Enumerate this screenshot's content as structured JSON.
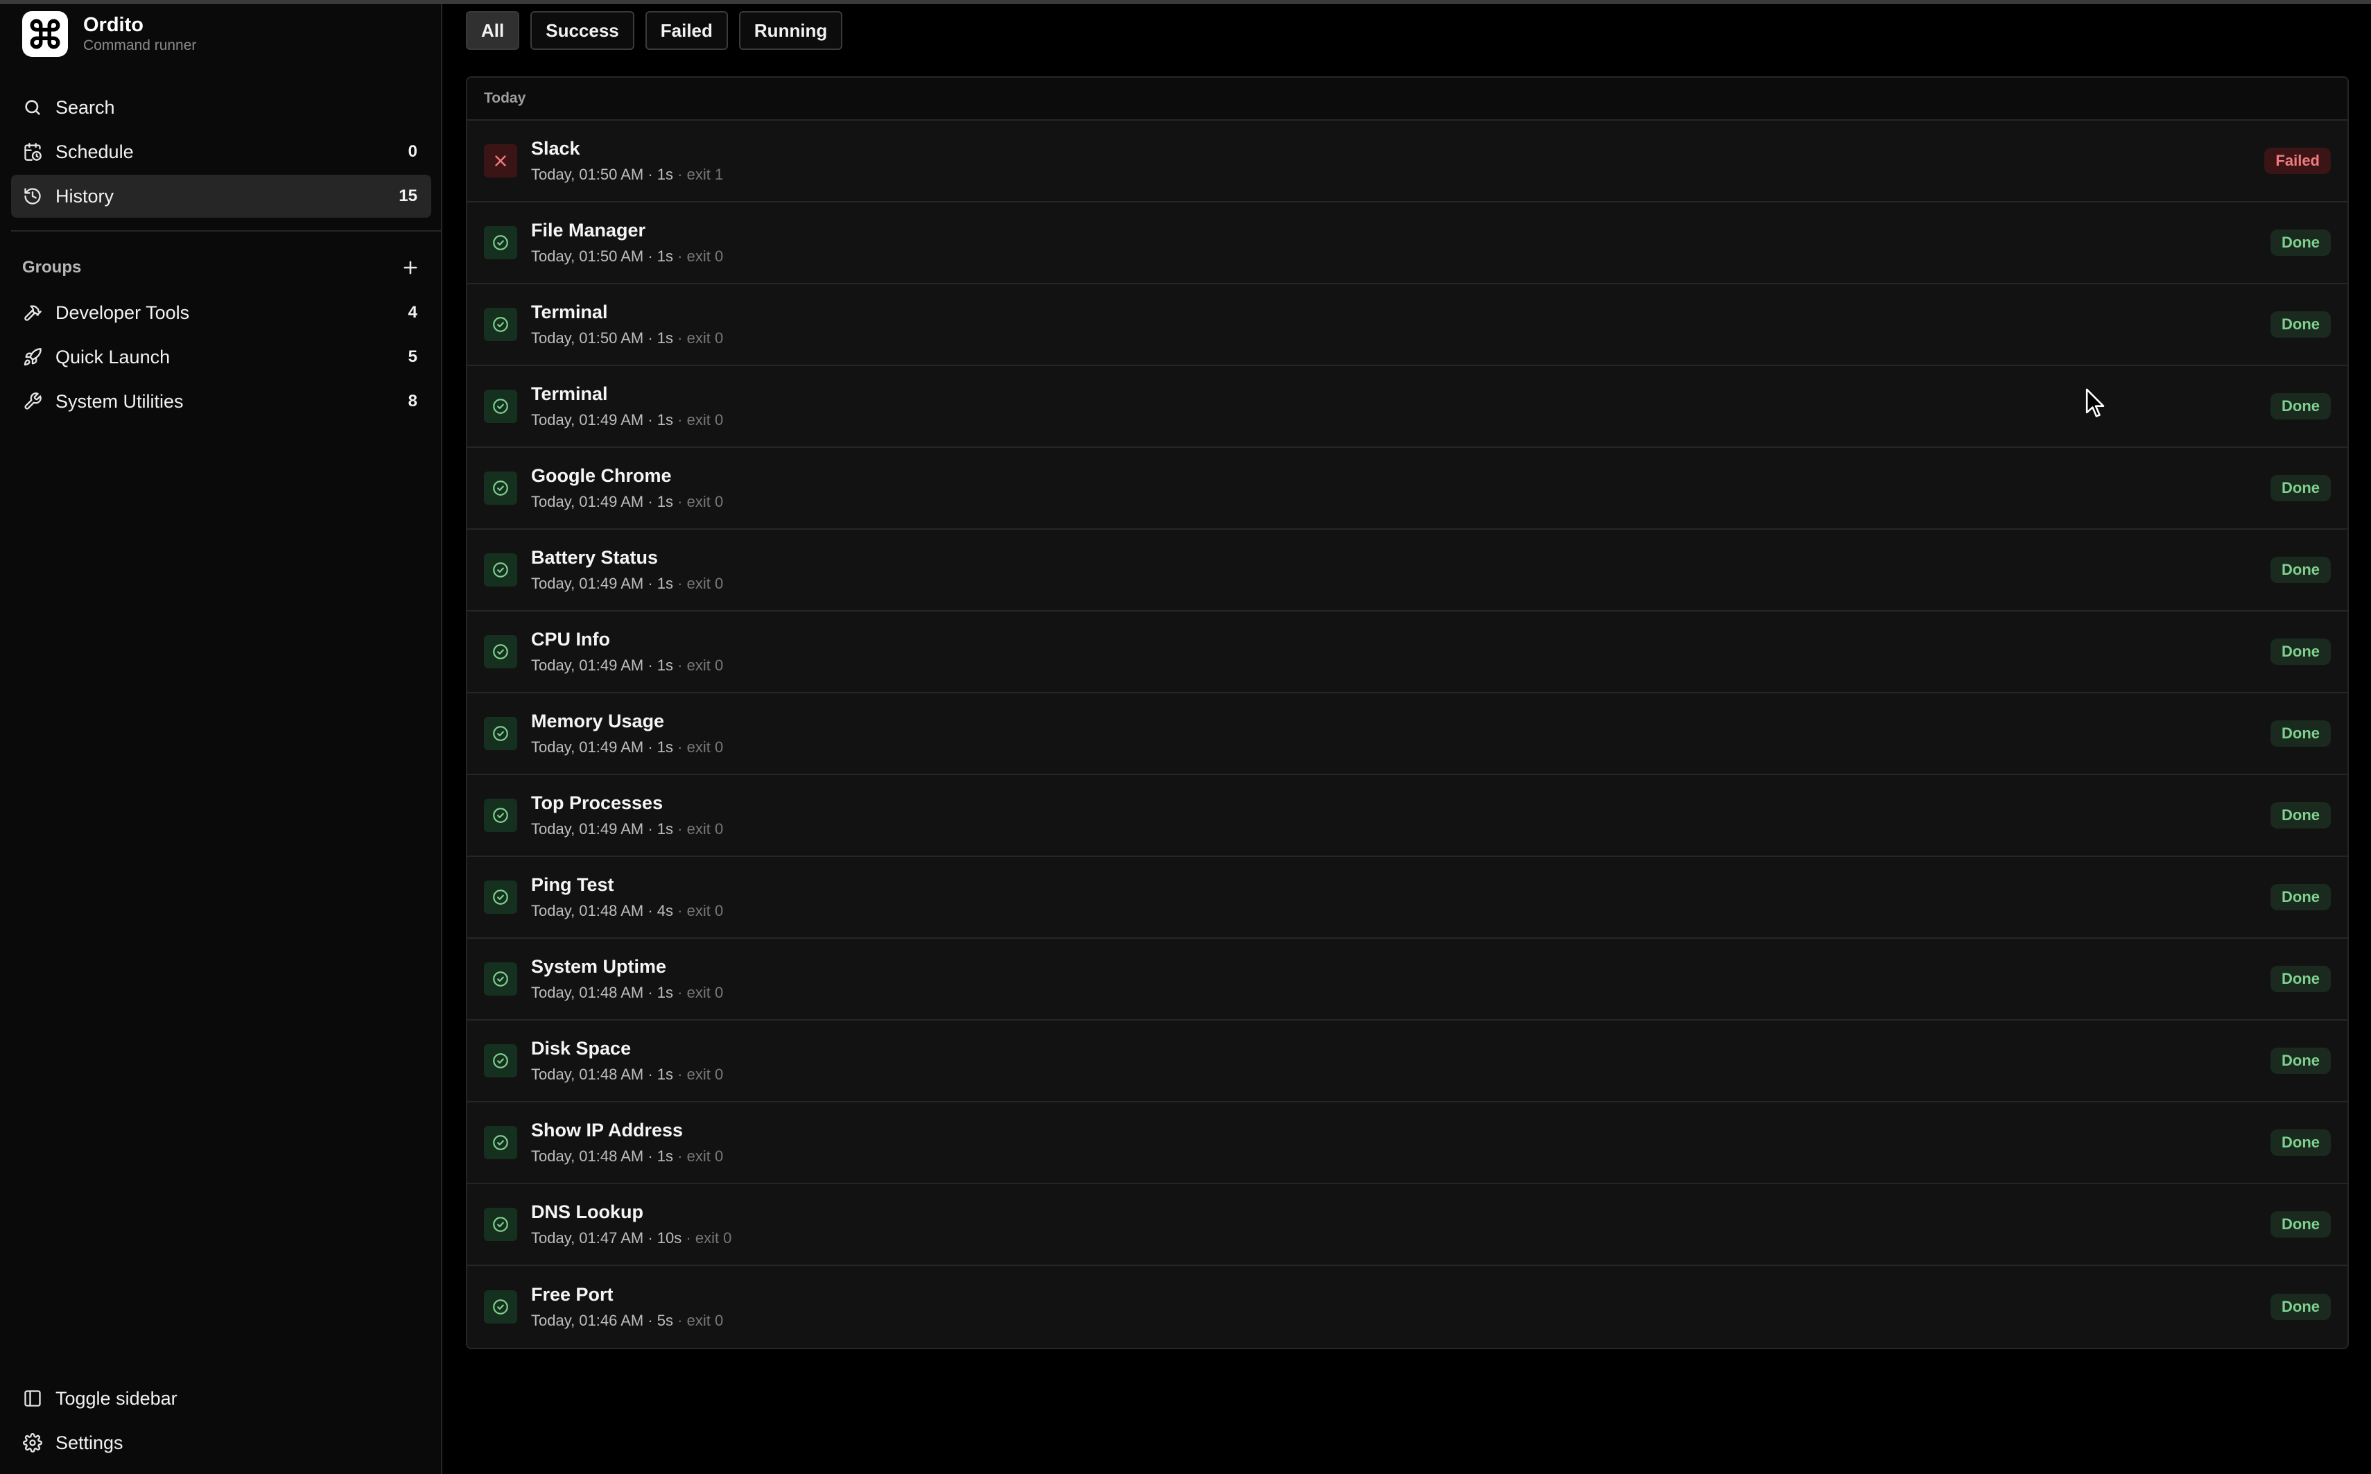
{
  "app": {
    "name": "Ordito",
    "subtitle": "Command runner"
  },
  "sidebar": {
    "nav": [
      {
        "label": "Search",
        "icon": "search-icon"
      },
      {
        "label": "Schedule",
        "count": "0",
        "icon": "calendar-clock-icon"
      },
      {
        "label": "History",
        "count": "15",
        "icon": "history-icon",
        "active": true
      }
    ],
    "groups_title": "Groups",
    "groups": [
      {
        "label": "Developer Tools",
        "count": "4",
        "icon": "hammer-icon"
      },
      {
        "label": "Quick Launch",
        "count": "5",
        "icon": "rocket-icon"
      },
      {
        "label": "System Utilities",
        "count": "8",
        "icon": "wrench-icon"
      }
    ],
    "footer": [
      {
        "label": "Toggle sidebar",
        "icon": "sidebar-icon"
      },
      {
        "label": "Settings",
        "icon": "gear-icon"
      }
    ]
  },
  "filters": [
    {
      "label": "All",
      "active": true
    },
    {
      "label": "Success"
    },
    {
      "label": "Failed"
    },
    {
      "label": "Running"
    }
  ],
  "history": {
    "section_label": "Today",
    "rows": [
      {
        "title": "Slack",
        "meta": "Today, 01:50 AM · 1s",
        "exit": " · exit 1",
        "status": "Failed",
        "ok": false
      },
      {
        "title": "File Manager",
        "meta": "Today, 01:50 AM · 1s",
        "exit": " · exit 0",
        "status": "Done",
        "ok": true
      },
      {
        "title": "Terminal",
        "meta": "Today, 01:50 AM · 1s",
        "exit": " · exit 0",
        "status": "Done",
        "ok": true
      },
      {
        "title": "Terminal",
        "meta": "Today, 01:49 AM · 1s",
        "exit": " · exit 0",
        "status": "Done",
        "ok": true
      },
      {
        "title": "Google Chrome",
        "meta": "Today, 01:49 AM · 1s",
        "exit": " · exit 0",
        "status": "Done",
        "ok": true
      },
      {
        "title": "Battery Status",
        "meta": "Today, 01:49 AM · 1s",
        "exit": " · exit 0",
        "status": "Done",
        "ok": true
      },
      {
        "title": "CPU Info",
        "meta": "Today, 01:49 AM · 1s",
        "exit": " · exit 0",
        "status": "Done",
        "ok": true
      },
      {
        "title": "Memory Usage",
        "meta": "Today, 01:49 AM · 1s",
        "exit": " · exit 0",
        "status": "Done",
        "ok": true
      },
      {
        "title": "Top Processes",
        "meta": "Today, 01:49 AM · 1s",
        "exit": " · exit 0",
        "status": "Done",
        "ok": true
      },
      {
        "title": "Ping Test",
        "meta": "Today, 01:48 AM · 4s",
        "exit": " · exit 0",
        "status": "Done",
        "ok": true
      },
      {
        "title": "System Uptime",
        "meta": "Today, 01:48 AM · 1s",
        "exit": " · exit 0",
        "status": "Done",
        "ok": true
      },
      {
        "title": "Disk Space",
        "meta": "Today, 01:48 AM · 1s",
        "exit": " · exit 0",
        "status": "Done",
        "ok": true
      },
      {
        "title": "Show IP Address",
        "meta": "Today, 01:48 AM · 1s",
        "exit": " · exit 0",
        "status": "Done",
        "ok": true
      },
      {
        "title": "DNS Lookup",
        "meta": "Today, 01:47 AM · 10s",
        "exit": " · exit 0",
        "status": "Done",
        "ok": true
      },
      {
        "title": "Free Port",
        "meta": "Today, 01:46 AM · 5s",
        "exit": " · exit 0",
        "status": "Done",
        "ok": true
      }
    ]
  },
  "colors": {
    "success": "#7fd18f",
    "failure": "#f07a7e",
    "background": "#000000"
  }
}
